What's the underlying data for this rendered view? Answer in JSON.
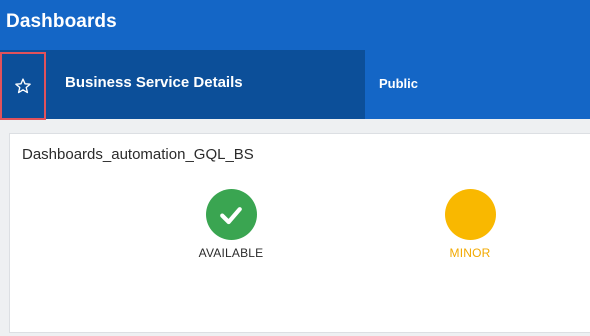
{
  "header": {
    "title": "Dashboards"
  },
  "subheader": {
    "favorite_icon": "star-outline-icon",
    "title": "Business Service Details",
    "visibility": "Public"
  },
  "card": {
    "title": "Dashboards_automation_GQL_BS",
    "statuses": [
      {
        "label": "AVAILABLE",
        "icon": "checkmark-icon",
        "color": "#3aa551",
        "label_color": "#2b2b2b"
      },
      {
        "label": "MINOR",
        "icon": "none",
        "color": "#f9b800",
        "label_color": "#f2a900"
      }
    ]
  },
  "colors": {
    "header_bg": "#1466c6",
    "subheader_bg": "#0c4f99",
    "highlight_border": "#e1525b"
  }
}
